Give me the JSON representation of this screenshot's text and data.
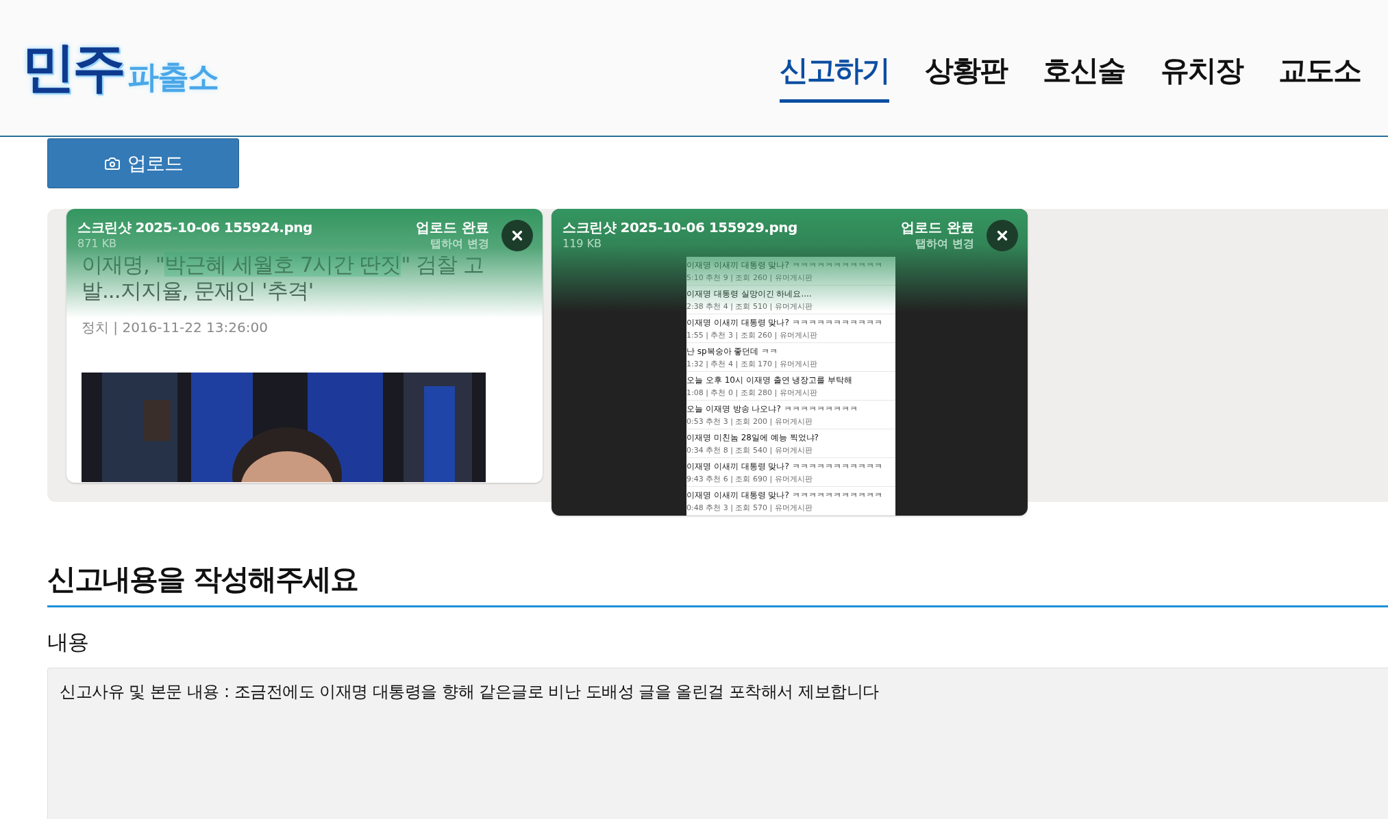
{
  "logo": {
    "main": "민주",
    "sub": "파출소"
  },
  "nav": [
    {
      "label": "신고하기",
      "selected": true
    },
    {
      "label": "상황판",
      "selected": false
    },
    {
      "label": "호신술",
      "selected": false
    },
    {
      "label": "유치장",
      "selected": false
    },
    {
      "label": "교도소",
      "selected": false
    }
  ],
  "upload_button": "업로드",
  "uploads": [
    {
      "kind": "article",
      "filename": "스크린샷 2025-10-06 155924.png",
      "size": "871 KB",
      "status": "업로드 완료",
      "hint": "탭하여 변경",
      "title": [
        {
          "text": "이재명, \"",
          "highlighted": false
        },
        {
          "text": "박근혜 세월호 7시간 딴짓",
          "highlighted": true
        },
        {
          "text": "\" 검찰 고발...지지율, 문재인 '추격'",
          "highlighted": false
        }
      ],
      "meta": "정치 | 2016-11-22 13:26:00"
    },
    {
      "kind": "list",
      "filename": "스크린샷 2025-10-06 155929.png",
      "size": "119 KB",
      "status": "업로드 완료",
      "hint": "탭하여 변경",
      "rows": [
        {
          "title": "이재명 이새끼 대통령 맞나? ㅋㅋㅋㅋㅋㅋㅋㅋㅋㅋㅋ",
          "meta": "5:10   추천 9 | 조회 260 | 유머게시판"
        },
        {
          "title": "이재명 대통령 실망이긴 하네요....",
          "meta": "2:38   추천 4 | 조회 510 | 유머게시판"
        },
        {
          "title": "이재명 이새끼 대통령 맞나? ㅋㅋㅋㅋㅋㅋㅋㅋㅋㅋㅋ",
          "meta": "1:55 | 추천 3 | 조회 260 | 유머게시판"
        },
        {
          "title": "난 sp복숭아 좋던데 ㅋㅋ",
          "meta": "1:32 | 추천 4 | 조회 170 | 유머게시판"
        },
        {
          "title": "오늘 오후 10시 이재명 출연 냉장고를 부탁해",
          "meta": "1:08 | 추천 0 | 조회 280 | 유머게시판"
        },
        {
          "title": "오늘 이재명 방송 나오냐? ㅋㅋㅋㅋㅋㅋㅋㅋㅋ",
          "meta": "0:53   추천 3 | 조회 200 | 유머게시판"
        },
        {
          "title": "이재명 미친놈 28일에 예능 찍었냐?",
          "meta": "0:34   추천 8 | 조회 540 | 유머게시판"
        },
        {
          "title": "이재명 이새끼 대통령 맞나? ㅋㅋㅋㅋㅋㅋㅋㅋㅋㅋㅋ",
          "meta": "9:43   추천 6 | 조회 690 | 유머게시판"
        },
        {
          "title": "이재명 이새끼 대통령 맞나? ㅋㅋㅋㅋㅋㅋㅋㅋㅋㅋㅋ",
          "meta": "0:48   추천 3 | 조회 570 | 유머게시판"
        }
      ]
    }
  ],
  "section_title": "신고내용을 작성해주세요",
  "content_label": "내용",
  "content_value": "신고사유 및 본문 내용 : 조금전에도 이재명 대통령을 향해 같은글로 비난 도배성 글을 올린걸 포착해서 제보합니다"
}
